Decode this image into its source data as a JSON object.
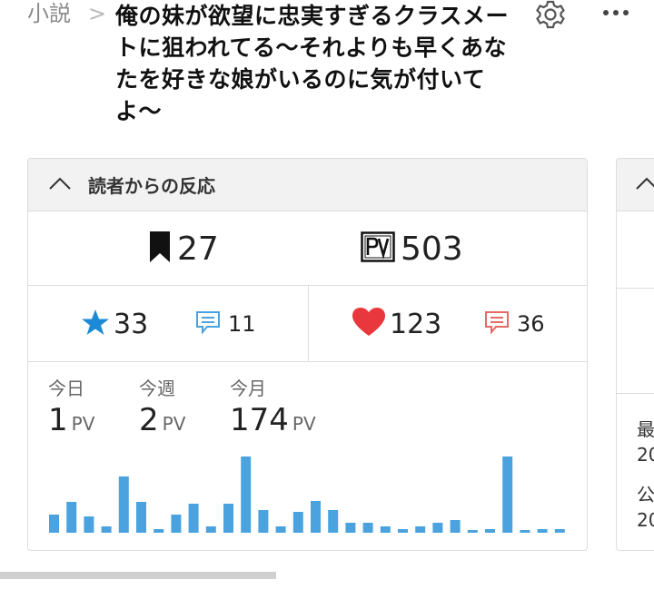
{
  "header": {
    "breadcrumb": "小説",
    "title": "俺の妹が欲望に忠実すぎるクラスメートに狙われてる〜それよりも早くあなたを好きな娘がいるのに気が付いてよ〜"
  },
  "reactions": {
    "heading": "読者からの反応",
    "bookmarks": "27",
    "pv_total": "503",
    "stars": "33",
    "reviews": "11",
    "likes": "123",
    "comments": "36"
  },
  "pv": {
    "today_label": "今日",
    "today_value": "1",
    "week_label": "今週",
    "week_value": "2",
    "month_label": "今月",
    "month_value": "174",
    "unit": "PV"
  },
  "side_panel": {
    "line1": "最",
    "line2": "20",
    "line3": "公",
    "line4": "20"
  },
  "colors": {
    "accent_blue": "#4aa3df",
    "star_blue": "#1c8ad6",
    "heart_red": "#e8383d",
    "comment_red": "#e56a6a"
  },
  "chart_data": {
    "type": "bar",
    "values": [
      20,
      34,
      18,
      7,
      62,
      34,
      4,
      20,
      32,
      7,
      32,
      84,
      25,
      7,
      23,
      35,
      25,
      11,
      11,
      7,
      4,
      7,
      11,
      14,
      0,
      4,
      84,
      0,
      4,
      4
    ],
    "ylim": [
      0,
      84
    ]
  }
}
